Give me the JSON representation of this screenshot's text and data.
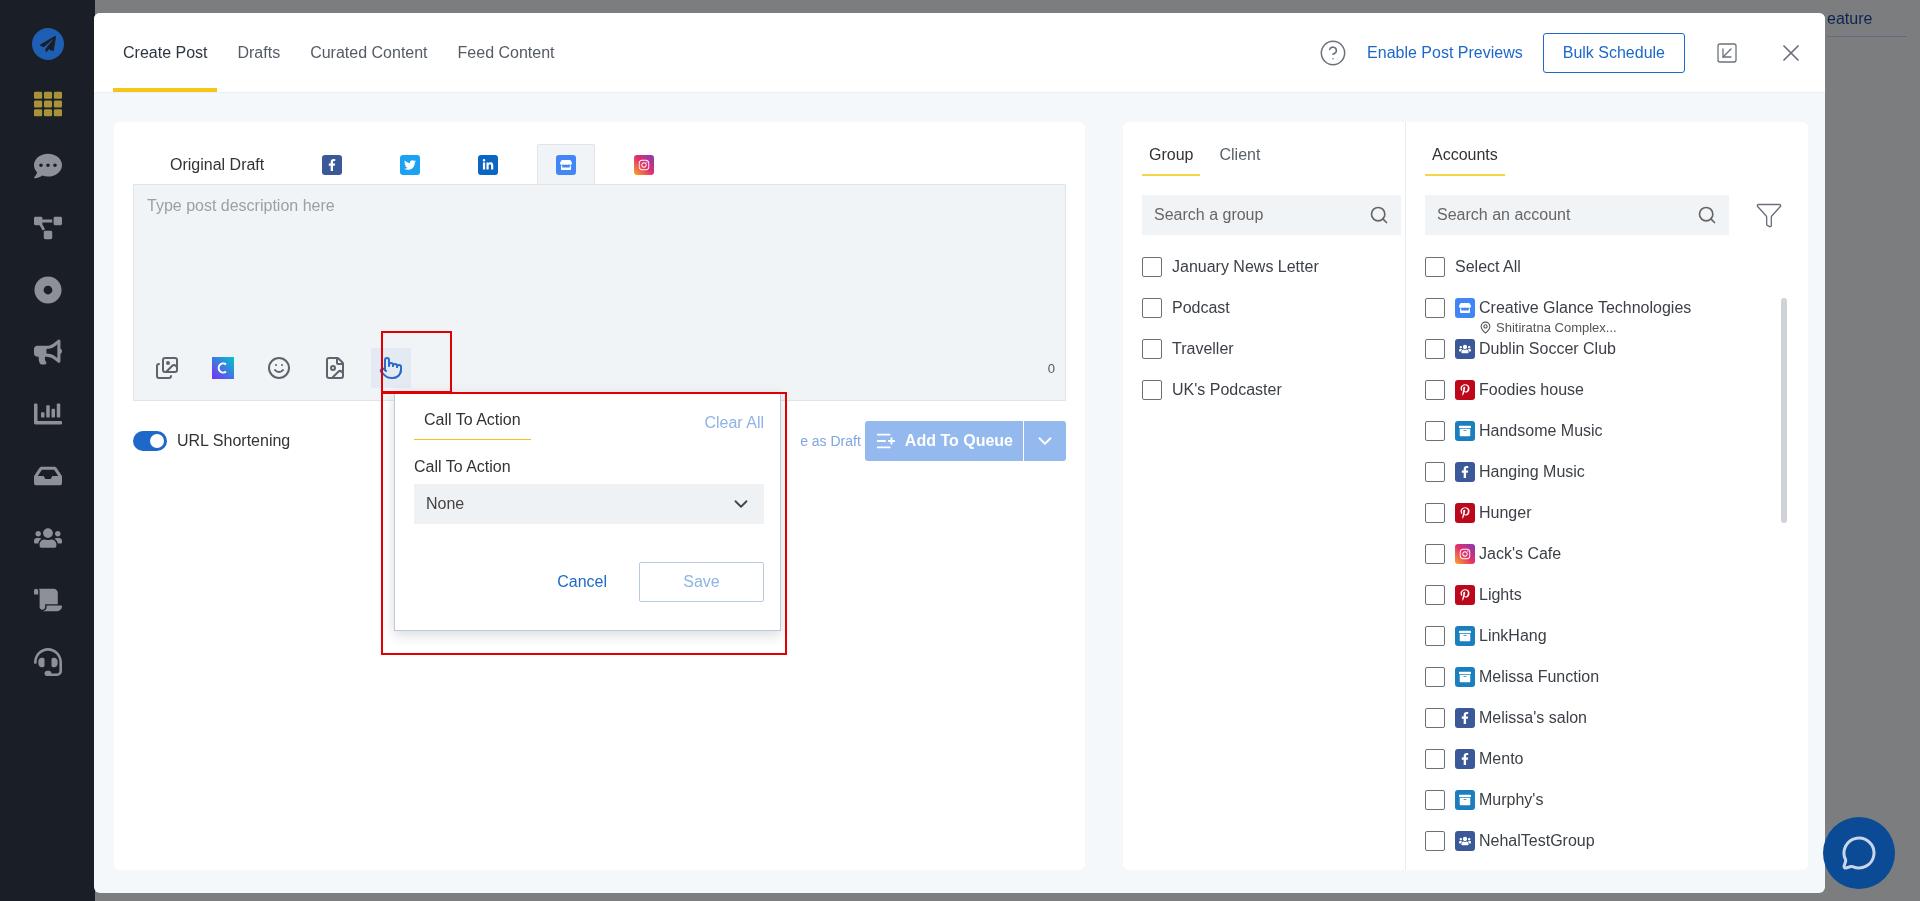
{
  "background": {
    "partial_link": "eature"
  },
  "sidebar": {
    "items": [
      {
        "kind": "dashboard",
        "selected": true
      },
      {
        "kind": "messages",
        "selected": false
      },
      {
        "kind": "network",
        "selected": false
      },
      {
        "kind": "orbit",
        "selected": false
      },
      {
        "kind": "campaign",
        "selected": false
      },
      {
        "kind": "reports",
        "selected": false
      },
      {
        "kind": "inbox",
        "selected": false
      },
      {
        "kind": "team",
        "selected": false
      },
      {
        "kind": "content",
        "selected": false
      },
      {
        "kind": "support",
        "selected": false
      }
    ]
  },
  "header": {
    "tabs": [
      {
        "label": "Create Post",
        "selected": true
      },
      {
        "label": "Drafts",
        "selected": false
      },
      {
        "label": "Curated Content",
        "selected": false
      },
      {
        "label": "Feed Content",
        "selected": false
      }
    ],
    "preview_link": "Enable Post Previews",
    "bulk_button": "Bulk Schedule"
  },
  "editor": {
    "network_tabs": [
      {
        "kind": "text",
        "label": "Original Draft",
        "selected": false
      },
      {
        "kind": "facebook",
        "selected": false
      },
      {
        "kind": "twitter",
        "selected": false
      },
      {
        "kind": "linkedin",
        "selected": false
      },
      {
        "kind": "business",
        "selected": true
      },
      {
        "kind": "instagram",
        "selected": false
      }
    ],
    "placeholder": "Type post description here",
    "char_count": "0",
    "tools": [
      {
        "kind": "media",
        "selected": false
      },
      {
        "kind": "canva",
        "selected": false
      },
      {
        "kind": "emoji",
        "selected": false
      },
      {
        "kind": "gif",
        "selected": false
      },
      {
        "kind": "cta",
        "selected": true
      }
    ],
    "url_shortening": {
      "label": "URL Shortening",
      "on": true
    },
    "save_draft": "e as Draft",
    "add_queue": "Add To Queue"
  },
  "cta_popup": {
    "tab": "Call To Action",
    "clear": "Clear All",
    "field_label": "Call To Action",
    "value": "None",
    "cancel": "Cancel",
    "save": "Save"
  },
  "groups": {
    "tabs": [
      {
        "label": "Group",
        "selected": true
      },
      {
        "label": "Client",
        "selected": false
      }
    ],
    "search_placeholder": "Search a group",
    "items": [
      {
        "label": "January News Letter",
        "checked": false
      },
      {
        "label": "Podcast",
        "checked": false
      },
      {
        "label": "Traveller",
        "checked": false
      },
      {
        "label": "UK's Podcaster",
        "checked": false
      }
    ]
  },
  "accounts": {
    "tab": "Accounts",
    "search_placeholder": "Search an account",
    "select_all": {
      "label": "Select All",
      "checked": false
    },
    "items": [
      {
        "name": "Creative Glance Technologies",
        "kind": "business",
        "location": "Shitiratna Complex...",
        "checked": false
      },
      {
        "name": "Dublin Soccer Club",
        "kind": "group",
        "checked": false
      },
      {
        "name": "Foodies house",
        "kind": "pinterest",
        "checked": false
      },
      {
        "name": "Handsome Music",
        "kind": "page",
        "checked": false
      },
      {
        "name": "Hanging Music",
        "kind": "facebook",
        "checked": false
      },
      {
        "name": "Hunger",
        "kind": "pinterest",
        "checked": false
      },
      {
        "name": "Jack's Cafe",
        "kind": "instagram",
        "checked": false
      },
      {
        "name": "Lights",
        "kind": "pinterest",
        "checked": false
      },
      {
        "name": "LinkHang",
        "kind": "page",
        "checked": false
      },
      {
        "name": "Melissa Function",
        "kind": "page",
        "checked": false
      },
      {
        "name": "Melissa's salon",
        "kind": "facebook",
        "checked": false
      },
      {
        "name": "Mento",
        "kind": "facebook",
        "checked": false
      },
      {
        "name": "Murphy's",
        "kind": "page",
        "checked": false
      },
      {
        "name": "NehalTestGroup",
        "kind": "group",
        "checked": false
      }
    ]
  }
}
